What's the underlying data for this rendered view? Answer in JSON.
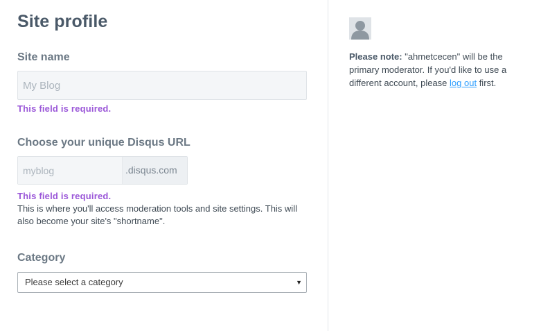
{
  "page": {
    "title": "Site profile"
  },
  "site_name": {
    "label": "Site name",
    "placeholder": "My Blog",
    "value": "",
    "error": "This field is required."
  },
  "disqus_url": {
    "label": "Choose your unique Disqus URL",
    "placeholder": "myblog",
    "value": "",
    "suffix": ".disqus.com",
    "error": "This field is required.",
    "help": "This is where you'll access moderation tools and site settings. This will also become your site's \"shortname\"."
  },
  "category": {
    "label": "Category",
    "selected": "Please select a category"
  },
  "sidebar": {
    "note_label": "Please note:",
    "note_text_1": " \"ahmetcecen\" will be the primary moderator. If you'd like to use a different account, please ",
    "logout_link": "log out",
    "note_text_2": " first."
  },
  "colors": {
    "error": "#9a56d8",
    "link": "#2e9fff",
    "heading": "#4a5968",
    "label": "#6b7884"
  }
}
